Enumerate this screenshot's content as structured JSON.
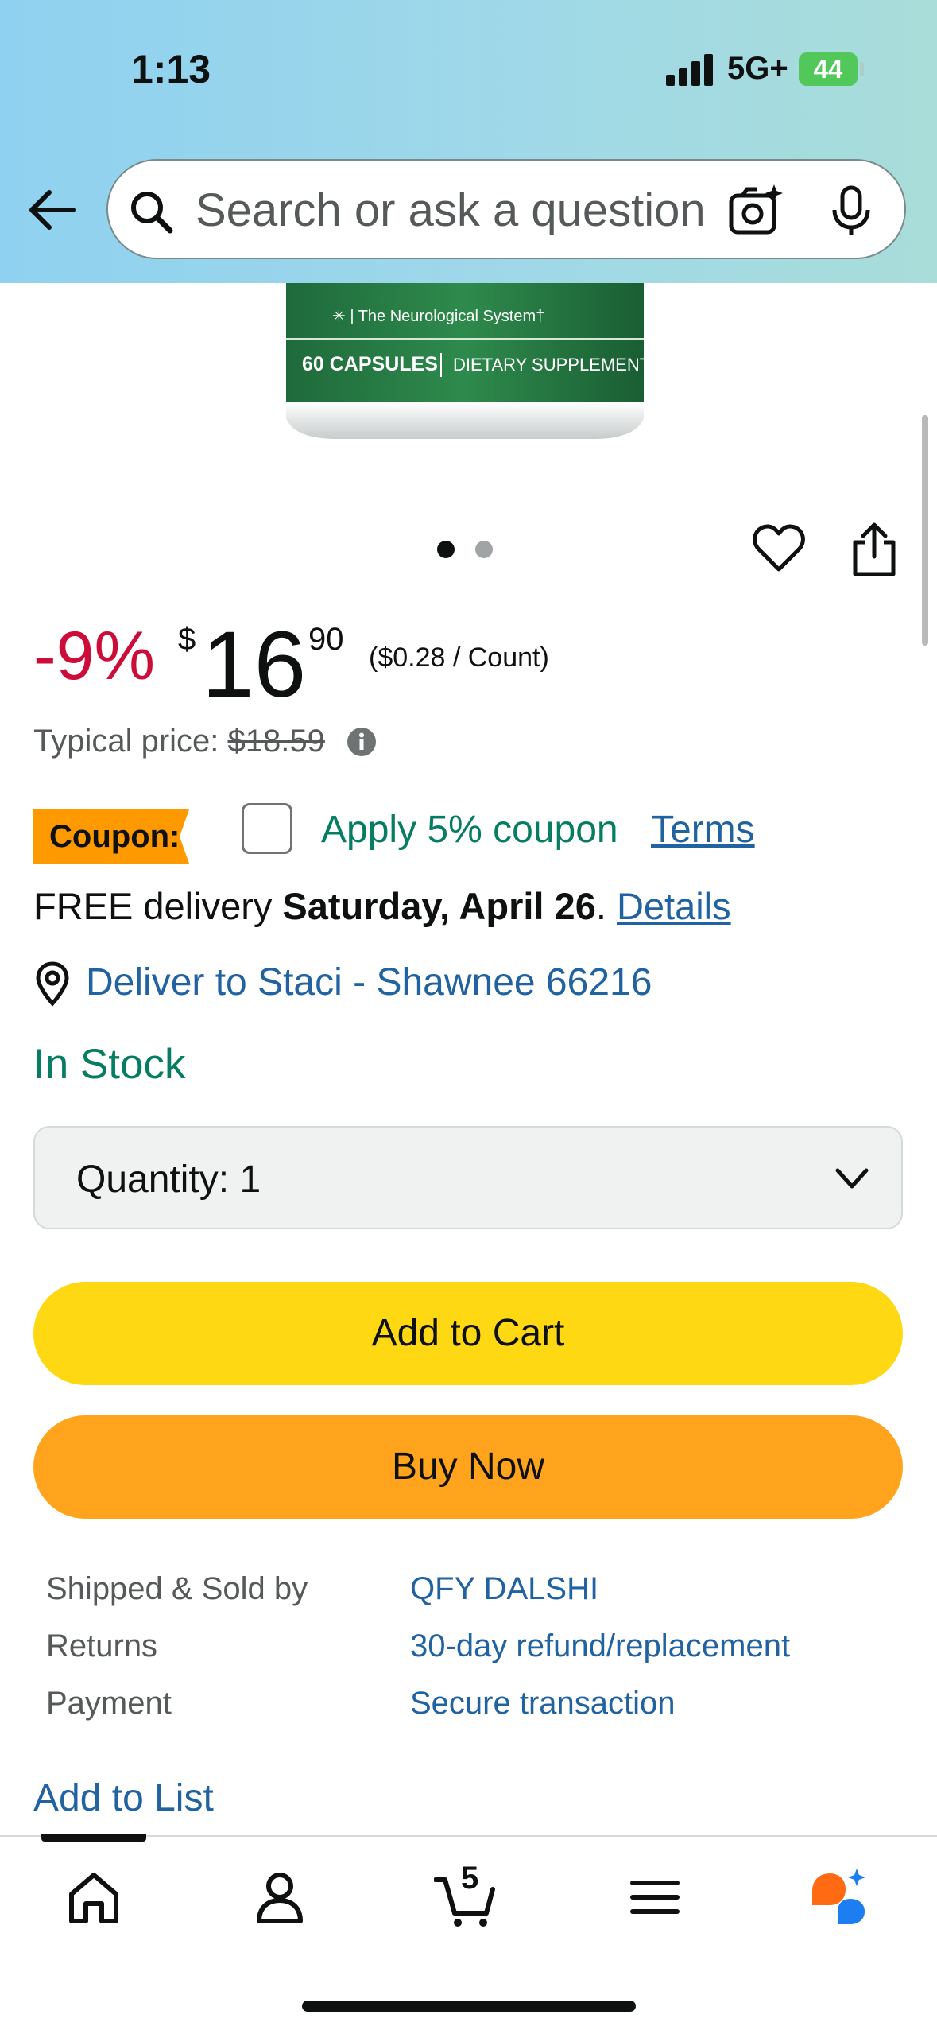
{
  "status_bar": {
    "time": "1:13",
    "network": "5G+",
    "battery": "44"
  },
  "search": {
    "placeholder": "Search or ask a question"
  },
  "product_image": {
    "line_1": "The Neurological System†",
    "capsules": "60 CAPSULES",
    "supplement": "DIETARY SUPPLEMENT"
  },
  "carousel": {
    "count": 2,
    "active_index": 0
  },
  "price": {
    "discount": "-9%",
    "currency": "$",
    "whole": "16",
    "fraction": "90",
    "per_unit": "($0.28 / Count)",
    "typical_label": "Typical price: ",
    "typical_value": "$18.59"
  },
  "coupon": {
    "badge": "Coupon:",
    "apply_label": "Apply 5% coupon",
    "terms": "Terms"
  },
  "delivery": {
    "prefix": "FREE delivery ",
    "date": "Saturday, April 26",
    "suffix": ". ",
    "details": "Details",
    "deliver_to": "Deliver to Staci - Shawnee 66216"
  },
  "stock": "In Stock",
  "quantity": {
    "label": "Quantity: ",
    "value": "1"
  },
  "buttons": {
    "add_to_cart": "Add to Cart",
    "buy_now": "Buy Now"
  },
  "details": [
    {
      "key": "Shipped & Sold by",
      "value": "QFY DALSHI"
    },
    {
      "key": "Returns",
      "value": "30-day refund/replacement"
    },
    {
      "key": "Payment",
      "value": "Secure transaction"
    }
  ],
  "add_to_list": "Add to List",
  "tab_bar": {
    "cart_count": "5"
  },
  "colors": {
    "discount": "#cc0c39",
    "link": "#2162a1",
    "stock": "#067d62",
    "add_to_cart": "#ffd814",
    "buy_now": "#ffa41c",
    "coupon_badge": "#ff9900"
  }
}
